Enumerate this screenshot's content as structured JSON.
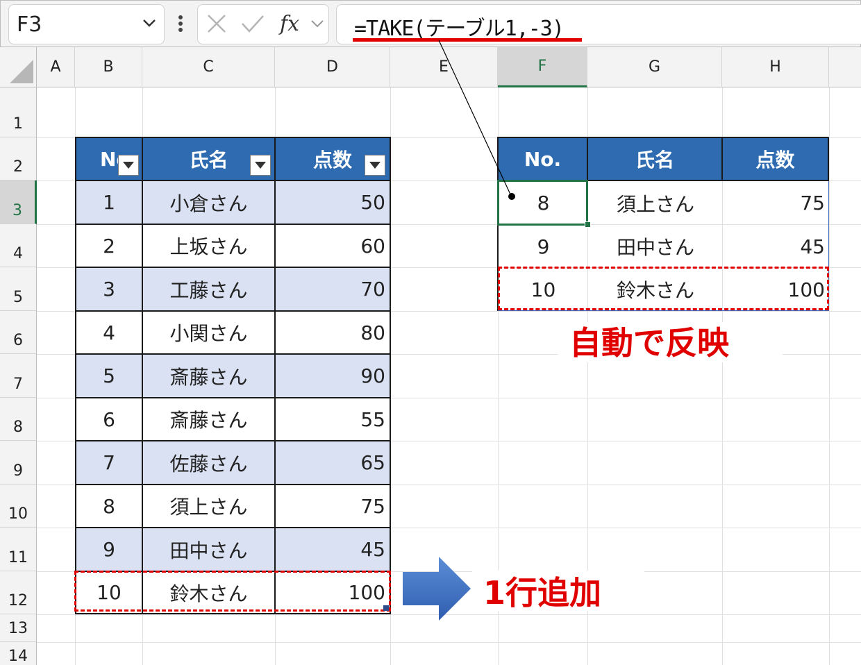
{
  "namebox": {
    "value": "F3"
  },
  "formula_bar": {
    "formula": "=TAKE(テーブル1,-3)"
  },
  "columns": [
    "A",
    "B",
    "C",
    "D",
    "E",
    "F",
    "G",
    "H"
  ],
  "rows": [
    "1",
    "2",
    "3",
    "4",
    "5",
    "6",
    "7",
    "8",
    "9",
    "10",
    "11",
    "12",
    "13",
    "14"
  ],
  "source_table": {
    "headers": [
      "No",
      "氏名",
      "点数"
    ],
    "rows": [
      [
        "1",
        "小倉さん",
        "50"
      ],
      [
        "2",
        "上坂さん",
        "60"
      ],
      [
        "3",
        "工藤さん",
        "70"
      ],
      [
        "4",
        "小関さん",
        "80"
      ],
      [
        "5",
        "斎藤さん",
        "90"
      ],
      [
        "6",
        "斎藤さん",
        "55"
      ],
      [
        "7",
        "佐藤さん",
        "65"
      ],
      [
        "8",
        "須上さん",
        "75"
      ],
      [
        "9",
        "田中さん",
        "45"
      ],
      [
        "10",
        "鈴木さん",
        "100"
      ]
    ]
  },
  "result_table": {
    "headers": [
      "No.",
      "氏名",
      "点数"
    ],
    "rows": [
      [
        "8",
        "須上さん",
        "75"
      ],
      [
        "9",
        "田中さん",
        "45"
      ],
      [
        "10",
        "鈴木さん",
        "100"
      ]
    ]
  },
  "annotations": {
    "auto_reflect": "自動で反映",
    "add_row": "1行追加"
  },
  "colors": {
    "header_blue": "#2e6bb0",
    "band": "#d9e1f2",
    "highlight_red": "#e00000",
    "excel_green": "#217346"
  }
}
